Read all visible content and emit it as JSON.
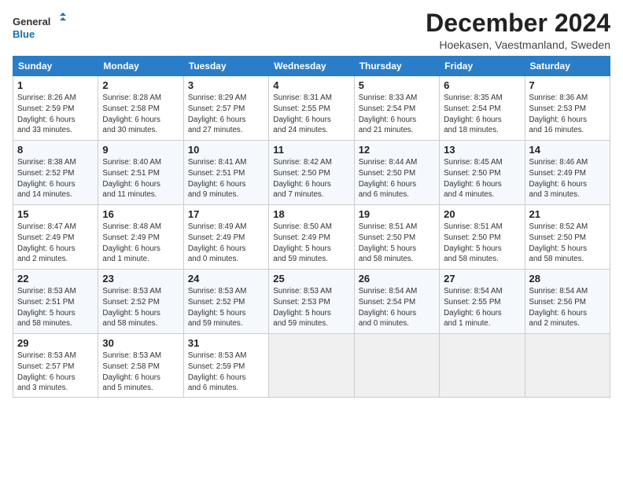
{
  "logo": {
    "line1": "General",
    "line2": "Blue"
  },
  "title": "December 2024",
  "location": "Hoekasen, Vaestmanland, Sweden",
  "weekdays": [
    "Sunday",
    "Monday",
    "Tuesday",
    "Wednesday",
    "Thursday",
    "Friday",
    "Saturday"
  ],
  "weeks": [
    [
      {
        "day": "1",
        "info": "Sunrise: 8:26 AM\nSunset: 2:59 PM\nDaylight: 6 hours\nand 33 minutes."
      },
      {
        "day": "2",
        "info": "Sunrise: 8:28 AM\nSunset: 2:58 PM\nDaylight: 6 hours\nand 30 minutes."
      },
      {
        "day": "3",
        "info": "Sunrise: 8:29 AM\nSunset: 2:57 PM\nDaylight: 6 hours\nand 27 minutes."
      },
      {
        "day": "4",
        "info": "Sunrise: 8:31 AM\nSunset: 2:55 PM\nDaylight: 6 hours\nand 24 minutes."
      },
      {
        "day": "5",
        "info": "Sunrise: 8:33 AM\nSunset: 2:54 PM\nDaylight: 6 hours\nand 21 minutes."
      },
      {
        "day": "6",
        "info": "Sunrise: 8:35 AM\nSunset: 2:54 PM\nDaylight: 6 hours\nand 18 minutes."
      },
      {
        "day": "7",
        "info": "Sunrise: 8:36 AM\nSunset: 2:53 PM\nDaylight: 6 hours\nand 16 minutes."
      }
    ],
    [
      {
        "day": "8",
        "info": "Sunrise: 8:38 AM\nSunset: 2:52 PM\nDaylight: 6 hours\nand 14 minutes."
      },
      {
        "day": "9",
        "info": "Sunrise: 8:40 AM\nSunset: 2:51 PM\nDaylight: 6 hours\nand 11 minutes."
      },
      {
        "day": "10",
        "info": "Sunrise: 8:41 AM\nSunset: 2:51 PM\nDaylight: 6 hours\nand 9 minutes."
      },
      {
        "day": "11",
        "info": "Sunrise: 8:42 AM\nSunset: 2:50 PM\nDaylight: 6 hours\nand 7 minutes."
      },
      {
        "day": "12",
        "info": "Sunrise: 8:44 AM\nSunset: 2:50 PM\nDaylight: 6 hours\nand 6 minutes."
      },
      {
        "day": "13",
        "info": "Sunrise: 8:45 AM\nSunset: 2:50 PM\nDaylight: 6 hours\nand 4 minutes."
      },
      {
        "day": "14",
        "info": "Sunrise: 8:46 AM\nSunset: 2:49 PM\nDaylight: 6 hours\nand 3 minutes."
      }
    ],
    [
      {
        "day": "15",
        "info": "Sunrise: 8:47 AM\nSunset: 2:49 PM\nDaylight: 6 hours\nand 2 minutes."
      },
      {
        "day": "16",
        "info": "Sunrise: 8:48 AM\nSunset: 2:49 PM\nDaylight: 6 hours\nand 1 minute."
      },
      {
        "day": "17",
        "info": "Sunrise: 8:49 AM\nSunset: 2:49 PM\nDaylight: 6 hours\nand 0 minutes."
      },
      {
        "day": "18",
        "info": "Sunrise: 8:50 AM\nSunset: 2:49 PM\nDaylight: 5 hours\nand 59 minutes."
      },
      {
        "day": "19",
        "info": "Sunrise: 8:51 AM\nSunset: 2:50 PM\nDaylight: 5 hours\nand 58 minutes."
      },
      {
        "day": "20",
        "info": "Sunrise: 8:51 AM\nSunset: 2:50 PM\nDaylight: 5 hours\nand 58 minutes."
      },
      {
        "day": "21",
        "info": "Sunrise: 8:52 AM\nSunset: 2:50 PM\nDaylight: 5 hours\nand 58 minutes."
      }
    ],
    [
      {
        "day": "22",
        "info": "Sunrise: 8:53 AM\nSunset: 2:51 PM\nDaylight: 5 hours\nand 58 minutes."
      },
      {
        "day": "23",
        "info": "Sunrise: 8:53 AM\nSunset: 2:52 PM\nDaylight: 5 hours\nand 58 minutes."
      },
      {
        "day": "24",
        "info": "Sunrise: 8:53 AM\nSunset: 2:52 PM\nDaylight: 5 hours\nand 59 minutes."
      },
      {
        "day": "25",
        "info": "Sunrise: 8:53 AM\nSunset: 2:53 PM\nDaylight: 5 hours\nand 59 minutes."
      },
      {
        "day": "26",
        "info": "Sunrise: 8:54 AM\nSunset: 2:54 PM\nDaylight: 6 hours\nand 0 minutes."
      },
      {
        "day": "27",
        "info": "Sunrise: 8:54 AM\nSunset: 2:55 PM\nDaylight: 6 hours\nand 1 minute."
      },
      {
        "day": "28",
        "info": "Sunrise: 8:54 AM\nSunset: 2:56 PM\nDaylight: 6 hours\nand 2 minutes."
      }
    ],
    [
      {
        "day": "29",
        "info": "Sunrise: 8:53 AM\nSunset: 2:57 PM\nDaylight: 6 hours\nand 3 minutes."
      },
      {
        "day": "30",
        "info": "Sunrise: 8:53 AM\nSunset: 2:58 PM\nDaylight: 6 hours\nand 5 minutes."
      },
      {
        "day": "31",
        "info": "Sunrise: 8:53 AM\nSunset: 2:59 PM\nDaylight: 6 hours\nand 6 minutes."
      },
      null,
      null,
      null,
      null
    ]
  ]
}
